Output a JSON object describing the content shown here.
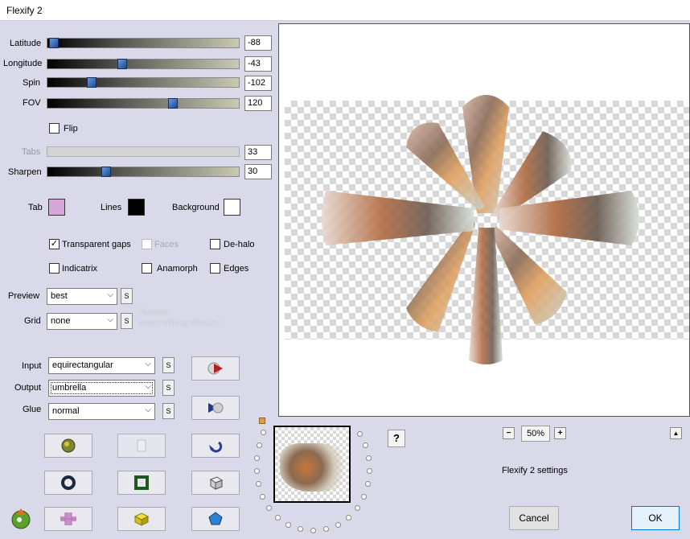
{
  "window": {
    "title": "Flexify 2"
  },
  "sliders": [
    {
      "label": "Latitude",
      "value": "-88",
      "position": 0.03
    },
    {
      "label": "Longitude",
      "value": "-43",
      "position": 0.38
    },
    {
      "label": "Spin",
      "value": "-102",
      "position": 0.23
    },
    {
      "label": "FOV",
      "value": "120",
      "position": 0.66
    },
    {
      "label": "Tabs",
      "value": "33",
      "position": 0.0,
      "disabled": true
    },
    {
      "label": "Sharpen",
      "value": "30",
      "position": 0.3
    }
  ],
  "flip": {
    "label": "Flip",
    "checked": false
  },
  "colors": {
    "tab": {
      "label": "Tab",
      "color": "#d9a6d8"
    },
    "lines": {
      "label": "Lines",
      "color": "#000000"
    },
    "background": {
      "label": "Background",
      "color": "#ffffff"
    }
  },
  "options": {
    "transparent_gaps": {
      "label": "Transparent gaps",
      "checked": true
    },
    "faces": {
      "label": "Faces",
      "checked": false,
      "disabled": true
    },
    "dehalo": {
      "label": "De-halo",
      "checked": false
    },
    "indicatrix": {
      "label": "Indicatrix",
      "checked": false
    },
    "anamorph": {
      "label": "Anamorph",
      "checked": false
    },
    "edges": {
      "label": "Edges",
      "checked": false
    }
  },
  "preview_select": {
    "label": "Preview",
    "value": "best"
  },
  "grid_select": {
    "label": "Grid",
    "value": "none"
  },
  "input_select": {
    "label": "Input",
    "value": "equirectangular"
  },
  "output_select": {
    "label": "Output",
    "value": "umbrella"
  },
  "glue_select": {
    "label": "Glue",
    "value": "normal"
  },
  "s_label": "S",
  "watermark": {
    "line1": "Pinuccia",
    "line2": "www.maidiregrafica.eu"
  },
  "zoom": {
    "value": "50%",
    "minus": "−",
    "plus": "+"
  },
  "help_label": "?",
  "scroll_up_label": "▲",
  "settings_label": "Flexify 2 settings",
  "buttons": {
    "cancel": "Cancel",
    "ok": "OK"
  },
  "accent_colors": {
    "slider_thumb": "#1a4a9a",
    "ok_border": "#0078d7",
    "dialog_bg": "#dad9e9"
  }
}
